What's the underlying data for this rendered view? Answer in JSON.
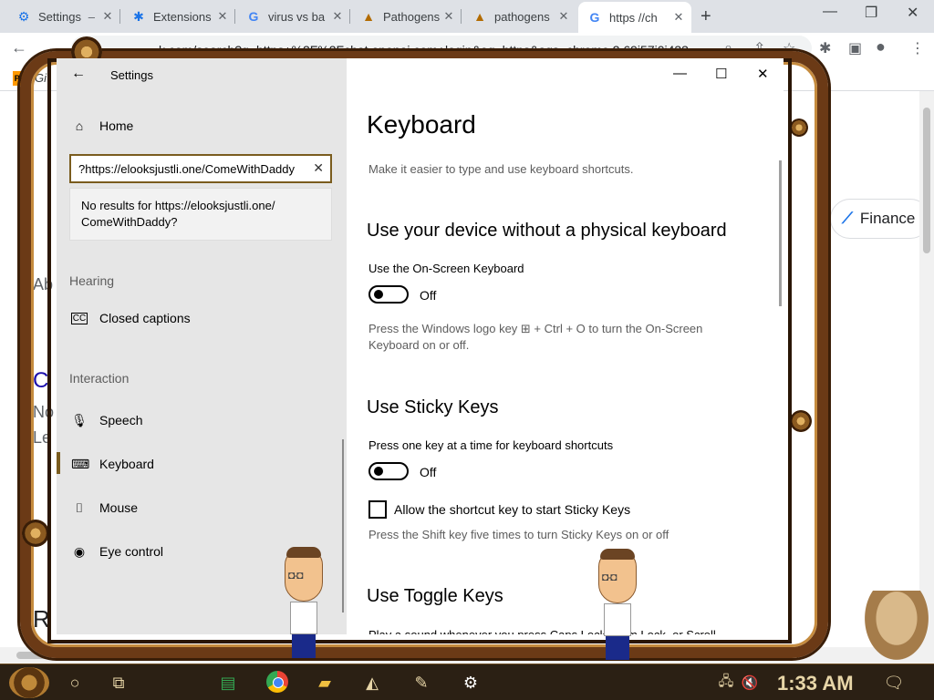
{
  "browser": {
    "tabs": [
      {
        "title": "Settings",
        "suffix": "–",
        "icon": "gear-icon",
        "icon_color": "#1a73e8"
      },
      {
        "title": "Extensions",
        "icon": "puzzle-icon",
        "icon_color": "#1a73e8"
      },
      {
        "title": "virus vs ba",
        "icon": "google-icon",
        "icon_color": "#4285f4"
      },
      {
        "title": "Pathogens",
        "icon": "warning-icon",
        "icon_color": "#b26b00"
      },
      {
        "title": "pathogens",
        "icon": "warning-icon",
        "icon_color": "#b26b00"
      },
      {
        "title": "https //ch",
        "icon": "google-icon",
        "icon_color": "#4285f4",
        "active": true
      }
    ],
    "new_tab": "+",
    "address": "k.com/search?q=https+%2F%2Fchat.openai.com+login&oq=https&aqs=chrome.2.69i57j0i433...",
    "bookmark_badge": "PH",
    "bookmark_label": "Gi",
    "finance_chip": "Finance",
    "bg_letters": [
      "Ab",
      "C",
      "No",
      "Le",
      "R"
    ]
  },
  "settings": {
    "window_title": "Settings",
    "nav_home": "Home",
    "search_value": "https://elooksjustli.one/ComeWithDaddy?",
    "search_no_results_line1": "No results for https://elooksjustli.one/",
    "search_no_results_line2": "ComeWithDaddy?",
    "section_hearing": "Hearing",
    "nav_closed_captions": "Closed captions",
    "section_interaction": "Interaction",
    "nav_speech": "Speech",
    "nav_keyboard": "Keyboard",
    "nav_mouse": "Mouse",
    "nav_eye_control": "Eye control",
    "page_title": "Keyboard",
    "page_desc": "Make it easier to type and use keyboard shortcuts.",
    "section1_title": "Use your device without a physical keyboard",
    "osk_label": "Use the On-Screen Keyboard",
    "osk_state": "Off",
    "osk_help_line1": "Press the Windows logo key ⊞ + Ctrl + O to turn the On-Screen",
    "osk_help_line2": "Keyboard on or off.",
    "section2_title": "Use Sticky Keys",
    "sticky_label": "Press one key at a time for keyboard shortcuts",
    "sticky_state": "Off",
    "sticky_shortcut_label": "Allow the shortcut key to start Sticky Keys",
    "sticky_help": "Press the Shift key five times to turn Sticky Keys on or off",
    "section3_title": "Use Toggle Keys",
    "toggle_help_partial": "Play a sound whenever you press Caps Lock, Num Lock, or Scroll"
  },
  "taskbar": {
    "time": "1:33 AM"
  },
  "colors": {
    "frame_brown": "#6b3a16",
    "accent_gold": "#7a5c1e",
    "sidebar_bg": "#e6e6e6"
  }
}
